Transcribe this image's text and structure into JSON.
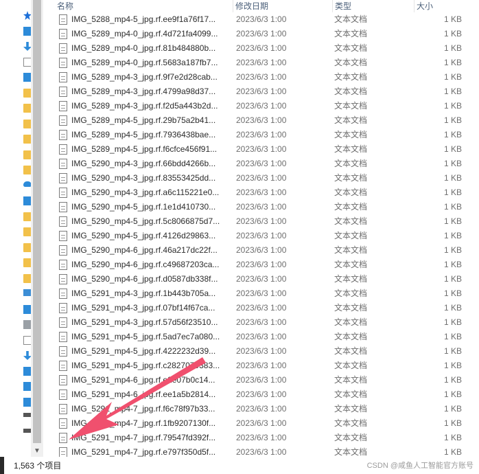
{
  "columns": {
    "name": "名称",
    "date": "修改日期",
    "type": "类型",
    "size": "大小"
  },
  "rows": [
    {
      "name": "IMG_5288_mp4-5_jpg.rf.ee9f1a76f17...",
      "date": "2023/6/3 1:00",
      "type": "文本文档",
      "size": "1 KB"
    },
    {
      "name": "IMG_5289_mp4-0_jpg.rf.4d721fa4099...",
      "date": "2023/6/3 1:00",
      "type": "文本文档",
      "size": "1 KB"
    },
    {
      "name": "IMG_5289_mp4-0_jpg.rf.81b484880b...",
      "date": "2023/6/3 1:00",
      "type": "文本文档",
      "size": "1 KB"
    },
    {
      "name": "IMG_5289_mp4-0_jpg.rf.5683a187fb7...",
      "date": "2023/6/3 1:00",
      "type": "文本文档",
      "size": "1 KB"
    },
    {
      "name": "IMG_5289_mp4-3_jpg.rf.9f7e2d28cab...",
      "date": "2023/6/3 1:00",
      "type": "文本文档",
      "size": "1 KB"
    },
    {
      "name": "IMG_5289_mp4-3_jpg.rf.4799a98d37...",
      "date": "2023/6/3 1:00",
      "type": "文本文档",
      "size": "1 KB"
    },
    {
      "name": "IMG_5289_mp4-3_jpg.rf.f2d5a443b2d...",
      "date": "2023/6/3 1:00",
      "type": "文本文档",
      "size": "1 KB"
    },
    {
      "name": "IMG_5289_mp4-5_jpg.rf.29b75a2b41...",
      "date": "2023/6/3 1:00",
      "type": "文本文档",
      "size": "1 KB"
    },
    {
      "name": "IMG_5289_mp4-5_jpg.rf.7936438bae...",
      "date": "2023/6/3 1:00",
      "type": "文本文档",
      "size": "1 KB"
    },
    {
      "name": "IMG_5289_mp4-5_jpg.rf.f6cfce456f91...",
      "date": "2023/6/3 1:00",
      "type": "文本文档",
      "size": "1 KB"
    },
    {
      "name": "IMG_5290_mp4-3_jpg.rf.66bdd4266b...",
      "date": "2023/6/3 1:00",
      "type": "文本文档",
      "size": "1 KB"
    },
    {
      "name": "IMG_5290_mp4-3_jpg.rf.83553425dd...",
      "date": "2023/6/3 1:00",
      "type": "文本文档",
      "size": "1 KB"
    },
    {
      "name": "IMG_5290_mp4-3_jpg.rf.a6c115221e0...",
      "date": "2023/6/3 1:00",
      "type": "文本文档",
      "size": "1 KB"
    },
    {
      "name": "IMG_5290_mp4-5_jpg.rf.1e1d410730...",
      "date": "2023/6/3 1:00",
      "type": "文本文档",
      "size": "1 KB"
    },
    {
      "name": "IMG_5290_mp4-5_jpg.rf.5c8066875d7...",
      "date": "2023/6/3 1:00",
      "type": "文本文档",
      "size": "1 KB"
    },
    {
      "name": "IMG_5290_mp4-5_jpg.rf.4126d29863...",
      "date": "2023/6/3 1:00",
      "type": "文本文档",
      "size": "1 KB"
    },
    {
      "name": "IMG_5290_mp4-6_jpg.rf.46a217dc22f...",
      "date": "2023/6/3 1:00",
      "type": "文本文档",
      "size": "1 KB"
    },
    {
      "name": "IMG_5290_mp4-6_jpg.rf.c49687203ca...",
      "date": "2023/6/3 1:00",
      "type": "文本文档",
      "size": "1 KB"
    },
    {
      "name": "IMG_5290_mp4-6_jpg.rf.d0587db338f...",
      "date": "2023/6/3 1:00",
      "type": "文本文档",
      "size": "1 KB"
    },
    {
      "name": "IMG_5291_mp4-3_jpg.rf.1b443b705a...",
      "date": "2023/6/3 1:00",
      "type": "文本文档",
      "size": "1 KB"
    },
    {
      "name": "IMG_5291_mp4-3_jpg.rf.07bf14f67ca...",
      "date": "2023/6/3 1:00",
      "type": "文本文档",
      "size": "1 KB"
    },
    {
      "name": "IMG_5291_mp4-3_jpg.rf.57d56f23510...",
      "date": "2023/6/3 1:00",
      "type": "文本文档",
      "size": "1 KB"
    },
    {
      "name": "IMG_5291_mp4-5_jpg.rf.5ad7ec7a080...",
      "date": "2023/6/3 1:00",
      "type": "文本文档",
      "size": "1 KB"
    },
    {
      "name": "IMG_5291_mp4-5_jpg.rf.4222232d39...",
      "date": "2023/6/3 1:00",
      "type": "文本文档",
      "size": "1 KB"
    },
    {
      "name": "IMG_5291_mp4-5_jpg.rf.c2827079383...",
      "date": "2023/6/3 1:00",
      "type": "文本文档",
      "size": "1 KB"
    },
    {
      "name": "IMG_5291_mp4-6_jpg.rf.e2e07b0c14...",
      "date": "2023/6/3 1:00",
      "type": "文本文档",
      "size": "1 KB"
    },
    {
      "name": "IMG_5291_mp4-6_jpg.rf.ee1a5b2814...",
      "date": "2023/6/3 1:00",
      "type": "文本文档",
      "size": "1 KB"
    },
    {
      "name": "IMG_5291_mp4-7_jpg.rf.f6c78f97b33...",
      "date": "2023/6/3 1:00",
      "type": "文本文档",
      "size": "1 KB"
    },
    {
      "name": "IMG_5291_mp4-7_jpg.rf.1fb9207130f...",
      "date": "2023/6/3 1:00",
      "type": "文本文档",
      "size": "1 KB"
    },
    {
      "name": "IMG_5291_mp4-7_jpg.rf.79547fd392f...",
      "date": "2023/6/3 1:00",
      "type": "文本文档",
      "size": "1 KB"
    },
    {
      "name": "IMG_5291_mp4-7_jpg.rf.e797f350d5f...",
      "date": "2023/6/3 1:00",
      "type": "文本文档",
      "size": "1 KB"
    }
  ],
  "nav_icons": [
    "star-icon",
    "blue-square-icon",
    "down-arrow-icon",
    "document-icon",
    "gallery-icon",
    "folder-icon",
    "folder-icon",
    "folder-icon",
    "folder-icon",
    "folder-icon",
    "folder-icon",
    "cloud-icon",
    "people-icon",
    "folder-icon",
    "folder-icon",
    "folder-icon",
    "folder-icon",
    "folder-icon",
    "computer-icon",
    "cube-icon",
    "film-icon",
    "document-icon",
    "down-arrow-icon",
    "music-icon",
    "picture-icon",
    "desktop-icon",
    "drive-icon",
    "drive-icon"
  ],
  "status": {
    "item_count": "1,563 个项目"
  },
  "watermark": "CSDN @咸鱼人工智能官方账号",
  "annotation": {
    "arrow_color": "#f0506e"
  }
}
